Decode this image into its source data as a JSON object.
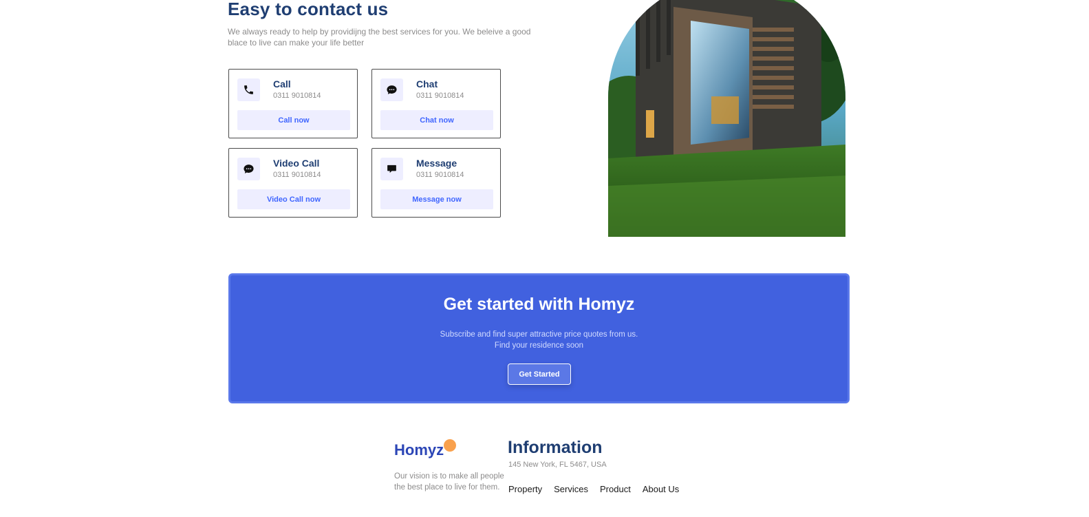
{
  "contact": {
    "title": "Easy to contact us",
    "description": "We always ready to help by providijng the best services for you. We beleive a good blace to live can make your life better",
    "cards": [
      {
        "title": "Call",
        "number": "0311 9010814",
        "button": "Call now",
        "icon": "phone-icon"
      },
      {
        "title": "Chat",
        "number": "0311 9010814",
        "button": "Chat now",
        "icon": "chat-bubble-icon"
      },
      {
        "title": "Video Call",
        "number": "0311 9010814",
        "button": "Video Call now",
        "icon": "chat-bubble-icon"
      },
      {
        "title": "Message",
        "number": "0311 9010814",
        "button": "Message now",
        "icon": "message-icon"
      }
    ],
    "accent_color": "#4066ff",
    "heading_color": "#1f3e72"
  },
  "banner": {
    "title": "Get started with Homyz",
    "subtitle_line1": "Subscribe and find super attractive price quotes from us.",
    "subtitle_line2": "Find your residence soon",
    "button": "Get Started",
    "background_color": "#4161df"
  },
  "footer": {
    "logo": "Homyz",
    "vision_line1": "Our vision is to make all people",
    "vision_line2": "the best place to live for them.",
    "info_title": "Information",
    "address": "145 New York, FL 5467, USA",
    "nav": [
      "Property",
      "Services",
      "Product",
      "About Us"
    ],
    "logo_dot_color": "#f9a14d"
  }
}
